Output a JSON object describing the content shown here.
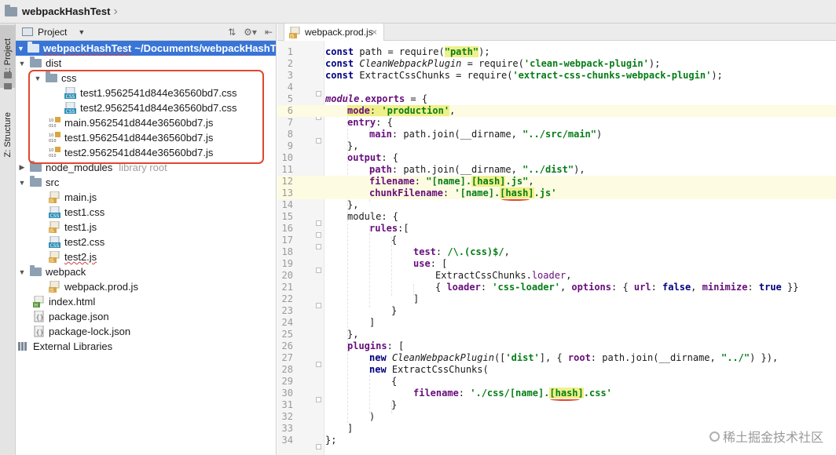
{
  "navbar": {
    "title": "webpackHashTest"
  },
  "toolstrip": {
    "project_tab": "1: Project",
    "structure_tab": "Z: Structure"
  },
  "project_panel": {
    "view_label": "Project",
    "root": {
      "name": "webpackHashTest",
      "path": "~/Documents/webpackHashTest"
    },
    "items": [
      {
        "label": "dist"
      },
      {
        "label": "css"
      },
      {
        "label": "test1.9562541d844e36560bd7.css"
      },
      {
        "label": "test2.9562541d844e36560bd7.css"
      },
      {
        "label": "main.9562541d844e36560bd7.js"
      },
      {
        "label": "test1.9562541d844e36560bd7.js"
      },
      {
        "label": "test2.9562541d844e36560bd7.js"
      },
      {
        "label": "node_modules",
        "hint": "library root"
      },
      {
        "label": "src"
      },
      {
        "label": "main.js"
      },
      {
        "label": "test1.css"
      },
      {
        "label": "test1.js"
      },
      {
        "label": "test2.css"
      },
      {
        "label": "test2.js"
      },
      {
        "label": "webpack"
      },
      {
        "label": "webpack.prod.js"
      },
      {
        "label": "index.html"
      },
      {
        "label": "package.json"
      },
      {
        "label": "package-lock.json"
      },
      {
        "label": "External Libraries"
      }
    ]
  },
  "editor": {
    "tab_label": "webpack.prod.js",
    "line_numbers": [
      "1",
      "2",
      "3",
      "4",
      "5",
      "6",
      "7",
      "8",
      "9",
      "10",
      "11",
      "12",
      "13",
      "14",
      "15",
      "16",
      "17",
      "18",
      "19",
      "20",
      "21",
      "22",
      "23",
      "24",
      "25",
      "26",
      "27",
      "28",
      "29",
      "30",
      "31",
      "32",
      "33",
      "34"
    ],
    "code": {
      "l1": {
        "kw": "const ",
        "a": "path = require(",
        "s": "\"path\"",
        "b": ");"
      },
      "l2": {
        "kw": "const ",
        "it": "CleanWebpackPlugin",
        "a": " = require(",
        "s": "'clean-webpack-plugin'",
        "b": ");"
      },
      "l3": {
        "kw": "const ",
        "a": "ExtractCssChunks = require(",
        "s": "'extract-css-chunks-webpack-plugin'",
        "b": ");"
      },
      "l5": {
        "it": "module",
        "a": ".",
        "p": "exports",
        "b": " = {"
      },
      "l6": {
        "p": "mode",
        "a": ": ",
        "s": "'production'",
        "b": ","
      },
      "l7": {
        "p": "entry",
        "a": ": {"
      },
      "l8": {
        "p": "main",
        "a": ": path.join(__dirname, ",
        "s": "\"../src/main\"",
        "b": ")"
      },
      "l9": "},",
      "l10": {
        "p": "output",
        "a": ": {"
      },
      "l11": {
        "p": "path",
        "a": ": path.join(__dirname, ",
        "s": "\"../dist\"",
        "b": "),"
      },
      "l12": {
        "p": "filename",
        "a": ": ",
        "s1": "\"[name].",
        "hash": "[hash]",
        "s2": ".js\"",
        "b": ","
      },
      "l13": {
        "p": "chunkFilename",
        "a": ": ",
        "s1": "'[name].",
        "hash": "[hash]",
        "s2": ".js'"
      },
      "l14": "},",
      "l15": {
        "a": "module: {"
      },
      "l16": {
        "p": "rules",
        "a": ":["
      },
      "l17": "{",
      "l18": {
        "p": "test",
        "a": ": ",
        "s": "/\\.(css)$/",
        "b": ","
      },
      "l19": {
        "p": "use",
        "a": ": ["
      },
      "l20": {
        "f": "ExtractCssChunks.",
        "g": "loader",
        "b": ","
      },
      "l21": {
        "a": "{ ",
        "p1": "loader",
        "b1": ": ",
        "s": "'css-loader'",
        "b2": ", ",
        "p2": "options",
        "b3": ": { ",
        "p3": "url",
        "b4": ": ",
        "k1": "false",
        "b5": ", ",
        "p4": "minimize",
        "b6": ": ",
        "k2": "true",
        "b7": " }}"
      },
      "l22": "]",
      "l23": "}",
      "l24": "]",
      "l25": "},",
      "l26": {
        "p": "plugins",
        "a": ": ["
      },
      "l27": {
        "kw": "new ",
        "it": "CleanWebpackPlugin",
        "a": "([",
        "s": "'dist'",
        "b": "], { ",
        "p": "root",
        "c": ": path.join(__dirname, ",
        "s2": "\"../\"",
        "d": ") }),"
      },
      "l28": {
        "kw": "new ",
        "a": "ExtractCssChunks("
      },
      "l29": "{",
      "l30": {
        "p": "filename",
        "a": ": ",
        "s1": "'./css/[name].",
        "hash": "[hash]",
        "s2": ".css'"
      },
      "l31": "}",
      "l32": ")",
      "l33": "]",
      "l34": "};"
    }
  },
  "watermark": {
    "text": "稀土掘金技术社区"
  },
  "colors": {
    "selection": "#3875d7",
    "annotation": "#e0472e",
    "keyword": "#000080",
    "string": "#067d17",
    "property": "#660e7a"
  }
}
